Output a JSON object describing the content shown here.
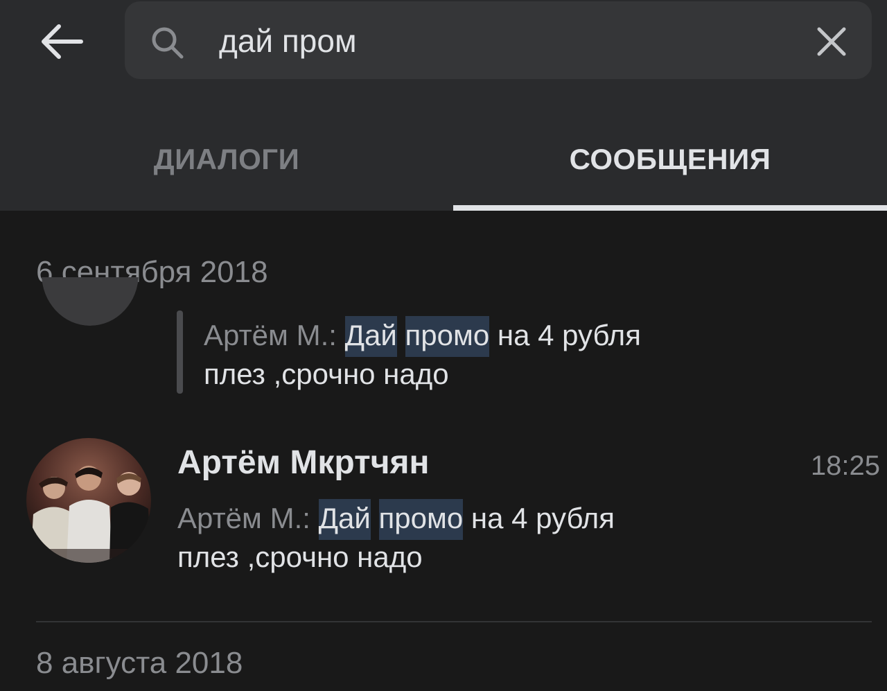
{
  "search": {
    "query": "дай пром",
    "back_icon": "arrow-left-icon",
    "search_icon": "search-icon",
    "clear_icon": "close-icon"
  },
  "tabs": [
    {
      "label": "ДИАЛОГИ",
      "active": false
    },
    {
      "label": "СООБЩЕНИЯ",
      "active": true
    }
  ],
  "sections": [
    {
      "date": "6 сентября 2018",
      "results": [
        {
          "sender_prefix": "Артём М.:",
          "highlight_1": "Дай",
          "highlight_2": "промо",
          "rest_line1": "на 4 рубля",
          "line2": "плез ,срочно надо"
        },
        {
          "name": "Артём Мкртчян",
          "time": "18:25",
          "sender_prefix": "Артём М.:",
          "highlight_1": "Дай",
          "highlight_2": "промо",
          "rest_line1": "на 4 рубля",
          "line2": "плез ,срочно надо"
        }
      ]
    },
    {
      "date": "8 августа 2018"
    }
  ],
  "colors": {
    "background": "#191919",
    "topbar": "#2a2b2d",
    "search_box": "#353638",
    "highlight": "#2c3a4d",
    "text_primary": "#e1e3e6",
    "text_secondary": "#8a8c90"
  }
}
